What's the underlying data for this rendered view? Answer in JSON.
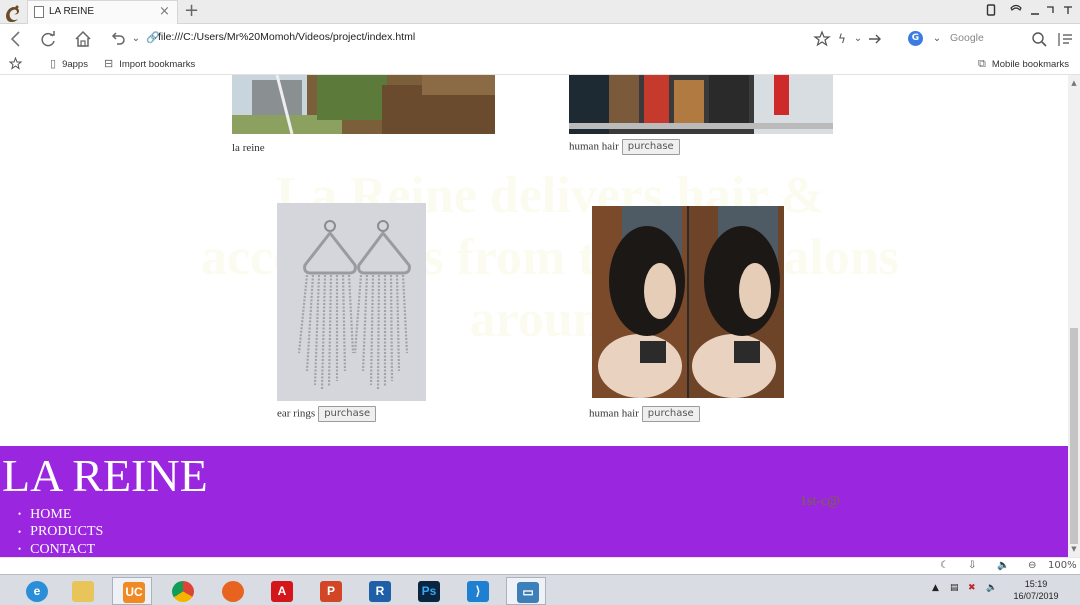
{
  "browser": {
    "tab_title": "LA REINE",
    "tab_close": "×",
    "new_tab": "+",
    "url": "file:///C:/Users/Mr%20Momoh/Videos/project/index.html",
    "search_engine_badge": "G",
    "search_placeholder": "Google",
    "bookmarks": [
      {
        "label": "9apps",
        "icon": "page-icon"
      },
      {
        "label": "Import bookmarks",
        "icon": "import-icon"
      }
    ],
    "mobile_bookmarks": "Mobile bookmarks",
    "zoom": "100%"
  },
  "page": {
    "watermark": "La Reine delivers hair & accessories from the best salons around",
    "products": [
      {
        "name": "la reine",
        "has_button": false,
        "image": "field-photo"
      },
      {
        "name": "human hair",
        "has_button": true,
        "image": "shop-photo"
      },
      {
        "name": "ear rings",
        "has_button": true,
        "image": "earrings-photo"
      },
      {
        "name": "human hair",
        "has_button": true,
        "image": "wig-photo"
      }
    ],
    "purchase_label": "purchase",
    "footer": {
      "brand": "LA REINE",
      "nav": [
        "HOME",
        "PRODUCTS",
        "CONTACT"
      ],
      "note": "1st-c@"
    }
  },
  "taskbar": {
    "apps": [
      "Internet Explorer",
      "File Explorer",
      "UC Browser",
      "Chrome",
      "Firefox",
      "Acrobat",
      "PowerPoint",
      "Revit",
      "Photoshop",
      "Visual Studio Code",
      "Photos"
    ],
    "time": "15:19",
    "date": "16/07/2019"
  },
  "colors": {
    "footer_bg": "#9a26e0",
    "chrome_bg": "#ececec",
    "taskbar_bg": "#d9dde3"
  }
}
